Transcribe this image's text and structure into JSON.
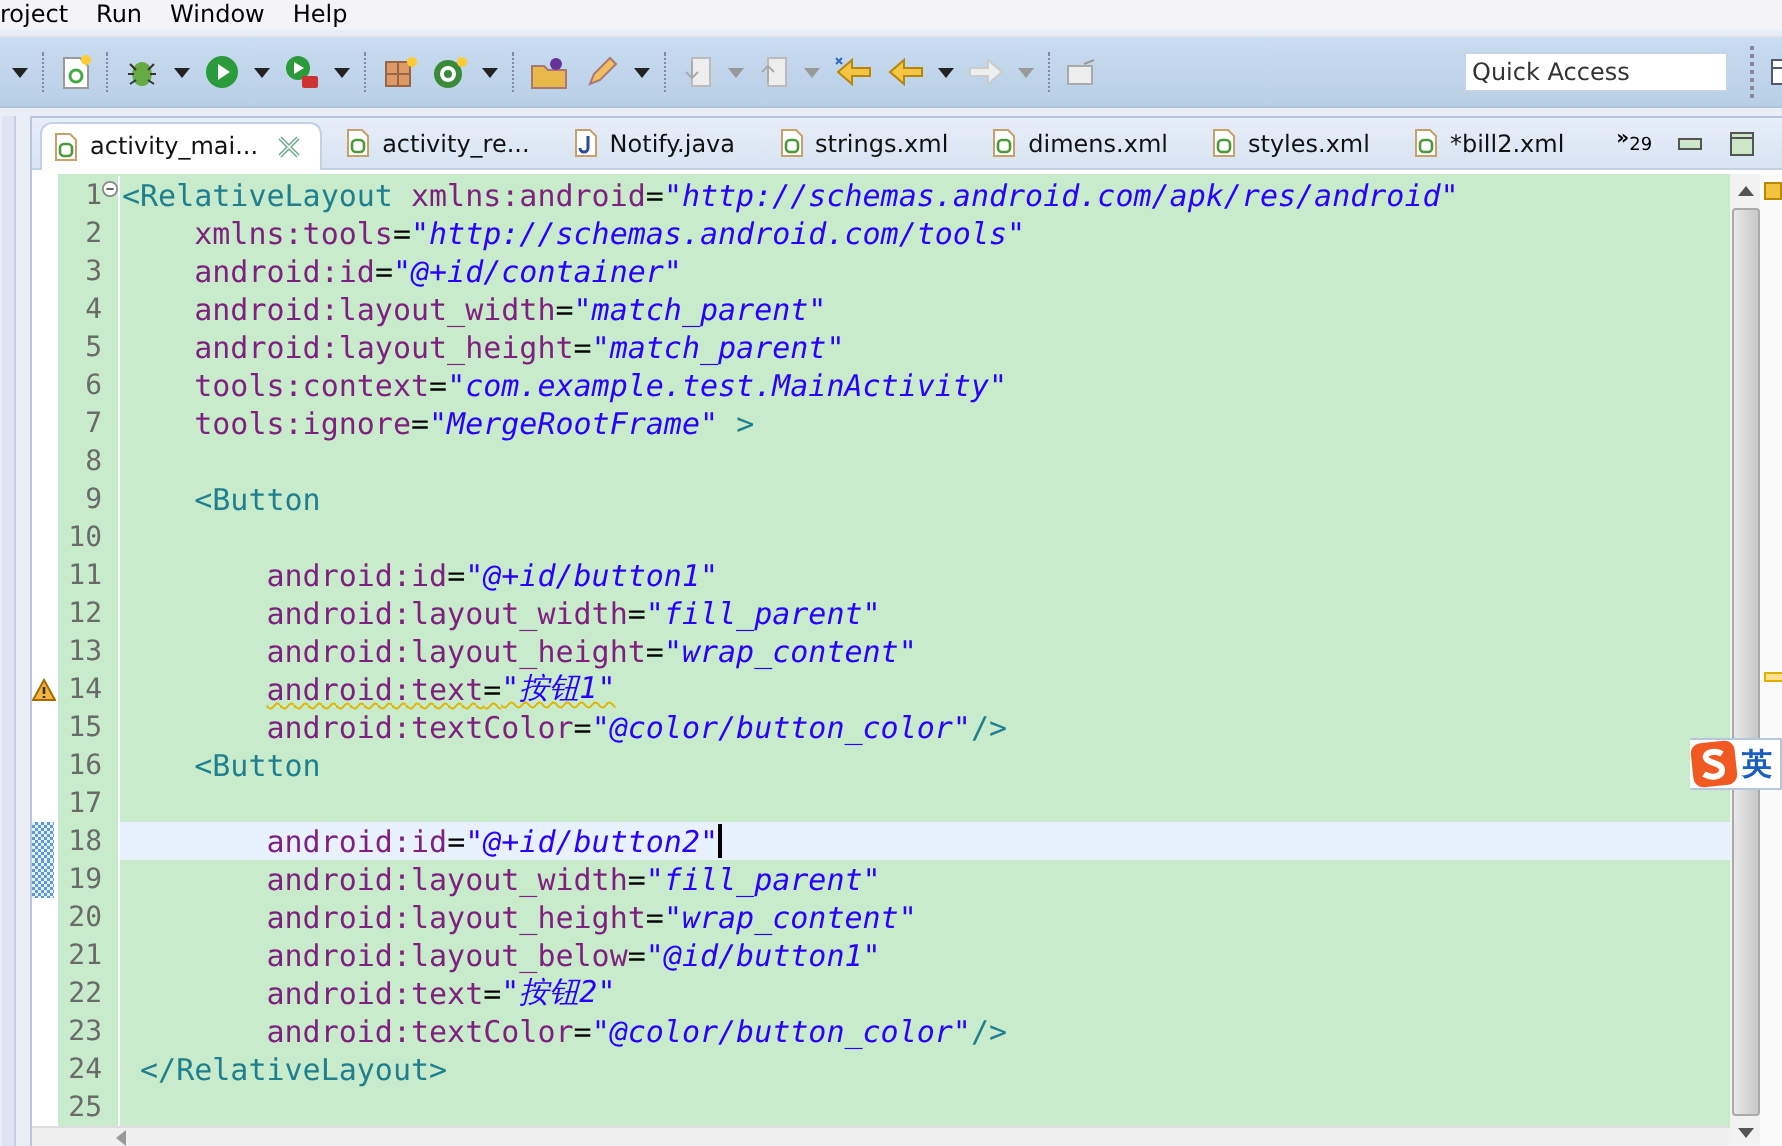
{
  "menu_bar": [
    "roject",
    "Run",
    "Window",
    "Help"
  ],
  "quick_access": {
    "placeholder": "Quick Access"
  },
  "tabs": [
    {
      "label": "activity_mai...",
      "kind": "xml",
      "selected": true,
      "closable": true
    },
    {
      "label": "activity_re...",
      "kind": "xml",
      "selected": false,
      "closable": false
    },
    {
      "label": "Notify.java",
      "kind": "java",
      "selected": false,
      "closable": false
    },
    {
      "label": "strings.xml",
      "kind": "xml",
      "selected": false,
      "closable": false
    },
    {
      "label": "dimens.xml",
      "kind": "xml",
      "selected": false,
      "closable": false
    },
    {
      "label": "styles.xml",
      "kind": "xml",
      "selected": false,
      "closable": false
    },
    {
      "label": "*bill2.xml",
      "kind": "xml",
      "selected": false,
      "closable": false
    }
  ],
  "tab_overflow": {
    "chevron": "»",
    "count": "29"
  },
  "editor_lines": [
    {
      "number": "1",
      "kind": "root-open",
      "fold": true,
      "warning": false,
      "changed": false,
      "current": false,
      "tag": "<RelativeLayout",
      "attr": "xmlns:android",
      "eq": "=",
      "value": "\"http://schemas.android.com/apk/res/android\""
    },
    {
      "number": "2",
      "kind": "root-attr",
      "fold": false,
      "warning": false,
      "changed": false,
      "current": false,
      "attr": "xmlns:tools",
      "eq": "=",
      "value": "\"http://schemas.android.com/tools\""
    },
    {
      "number": "3",
      "kind": "root-attr",
      "fold": false,
      "warning": false,
      "changed": false,
      "current": false,
      "attr": "android:id",
      "eq": "=",
      "value": "\"@+id/container\""
    },
    {
      "number": "4",
      "kind": "root-attr",
      "fold": false,
      "warning": false,
      "changed": false,
      "current": false,
      "attr": "android:layout_width",
      "eq": "=",
      "value": "\"match_parent\""
    },
    {
      "number": "5",
      "kind": "root-attr",
      "fold": false,
      "warning": false,
      "changed": false,
      "current": false,
      "attr": "android:layout_height",
      "eq": "=",
      "value": "\"match_parent\""
    },
    {
      "number": "6",
      "kind": "root-attr",
      "fold": false,
      "warning": false,
      "changed": false,
      "current": false,
      "attr": "tools:context",
      "eq": "=",
      "value": "\"com.example.test.MainActivity\""
    },
    {
      "number": "7",
      "kind": "root-attr",
      "fold": false,
      "warning": false,
      "changed": false,
      "current": false,
      "attr": "tools:ignore",
      "eq": "=",
      "value": "\"MergeRootFrame\"",
      "end": ">"
    },
    {
      "number": "8",
      "kind": "blank",
      "fold": false,
      "warning": false,
      "changed": false,
      "current": false
    },
    {
      "number": "9",
      "kind": "child-open",
      "fold": false,
      "warning": false,
      "changed": false,
      "current": false,
      "tag": "<Button"
    },
    {
      "number": "10",
      "kind": "blank",
      "fold": false,
      "warning": false,
      "changed": false,
      "current": false
    },
    {
      "number": "11",
      "kind": "child-attr",
      "fold": false,
      "warning": false,
      "changed": false,
      "current": false,
      "attr": "android:id",
      "eq": "=",
      "value": "\"@+id/button1\""
    },
    {
      "number": "12",
      "kind": "child-attr",
      "fold": false,
      "warning": false,
      "changed": false,
      "current": false,
      "attr": "android:layout_width",
      "eq": "=",
      "value": "\"fill_parent\""
    },
    {
      "number": "13",
      "kind": "child-attr",
      "fold": false,
      "warning": false,
      "changed": false,
      "current": false,
      "attr": "android:layout_height",
      "eq": "=",
      "value": "\"wrap_content\""
    },
    {
      "number": "14",
      "kind": "child-attr",
      "fold": false,
      "warning": true,
      "changed": false,
      "current": false,
      "attr": "android:text",
      "eq": "=",
      "value": "\"按钮1\""
    },
    {
      "number": "15",
      "kind": "child-attr",
      "fold": false,
      "warning": false,
      "changed": false,
      "current": false,
      "attr": "android:textColor",
      "eq": "=",
      "value": "\"@color/button_color\"",
      "self_close": "/>"
    },
    {
      "number": "16",
      "kind": "child-open",
      "fold": false,
      "warning": false,
      "changed": false,
      "current": false,
      "tag": "<Button"
    },
    {
      "number": "17",
      "kind": "blank",
      "fold": false,
      "warning": false,
      "changed": false,
      "current": false
    },
    {
      "number": "18",
      "kind": "child-attr",
      "fold": false,
      "warning": false,
      "changed": true,
      "current": true,
      "attr": "android:id",
      "eq": "=",
      "value": "\"@+id/button2\""
    },
    {
      "number": "19",
      "kind": "child-attr",
      "fold": false,
      "warning": false,
      "changed": true,
      "current": false,
      "attr": "android:layout_width",
      "eq": "=",
      "value": "\"fill_parent\""
    },
    {
      "number": "20",
      "kind": "child-attr",
      "fold": false,
      "warning": false,
      "changed": false,
      "current": false,
      "attr": "android:layout_height",
      "eq": "=",
      "value": "\"wrap_content\""
    },
    {
      "number": "21",
      "kind": "child-attr",
      "fold": false,
      "warning": false,
      "changed": false,
      "current": false,
      "attr": "android:layout_below",
      "eq": "=",
      "value": "\"@id/button1\""
    },
    {
      "number": "22",
      "kind": "child-attr",
      "fold": false,
      "warning": false,
      "changed": false,
      "current": false,
      "attr": "android:text",
      "eq": "=",
      "value": "\"按钮2\""
    },
    {
      "number": "23",
      "kind": "child-attr",
      "fold": false,
      "warning": false,
      "changed": false,
      "current": false,
      "attr": "android:textColor",
      "eq": "=",
      "value": "\"@color/button_color\"",
      "self_close": "/>"
    },
    {
      "number": "24",
      "kind": "root-close",
      "fold": false,
      "warning": false,
      "changed": false,
      "current": false,
      "tag": "</RelativeLayout>"
    },
    {
      "number": "25",
      "kind": "blank",
      "fold": false,
      "warning": false,
      "changed": false,
      "current": false
    }
  ],
  "ime_indicator": {
    "mode": "英"
  }
}
